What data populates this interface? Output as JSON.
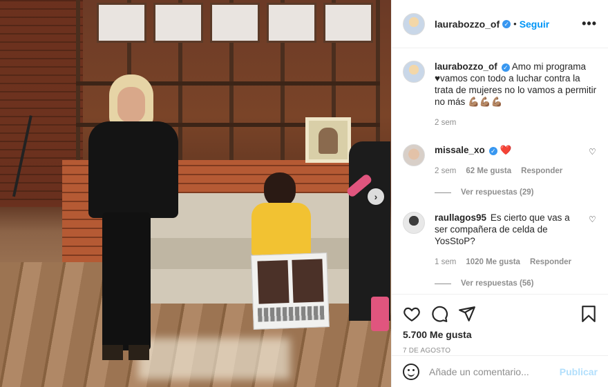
{
  "post": {
    "author": "laurabozzo_of",
    "follow_label": "Seguir",
    "more_icon": "more-options-icon",
    "caption": {
      "username": "laurabozzo_of",
      "text_line1": "Amo mi programa",
      "text_line2": "♥vamos con todo a luchar contra la trata de mujeres no lo vamos a permitir no más 💪🏽💪🏽💪🏽",
      "time": "2 sem"
    },
    "comments": [
      {
        "username": "missale_xo",
        "text": "❤️",
        "time": "2 sem",
        "likes": "62 Me gusta",
        "reply_label": "Responder",
        "view_replies": "Ver respuestas (29)"
      },
      {
        "username": "raullagos95",
        "text": "Es cierto que vas a ser compañera de celda de YosStoP?",
        "time": "1 sem",
        "likes": "1020 Me gusta",
        "reply_label": "Responder",
        "view_replies": "Ver respuestas (56)"
      }
    ],
    "likes_count": "5.700 Me gusta",
    "date": "7 DE AGOSTO",
    "add_comment_placeholder": "Añade un comentario...",
    "publish_label": "Publicar",
    "colors": {
      "accent": "#0095f6",
      "publish_disabled": "#b2dffc",
      "verified": "#3897f0",
      "muted": "#8e8e8e"
    },
    "icons": [
      "heart-icon",
      "comment-icon",
      "share-icon",
      "bookmark-icon",
      "emoji-icon",
      "next-arrow-icon"
    ]
  }
}
